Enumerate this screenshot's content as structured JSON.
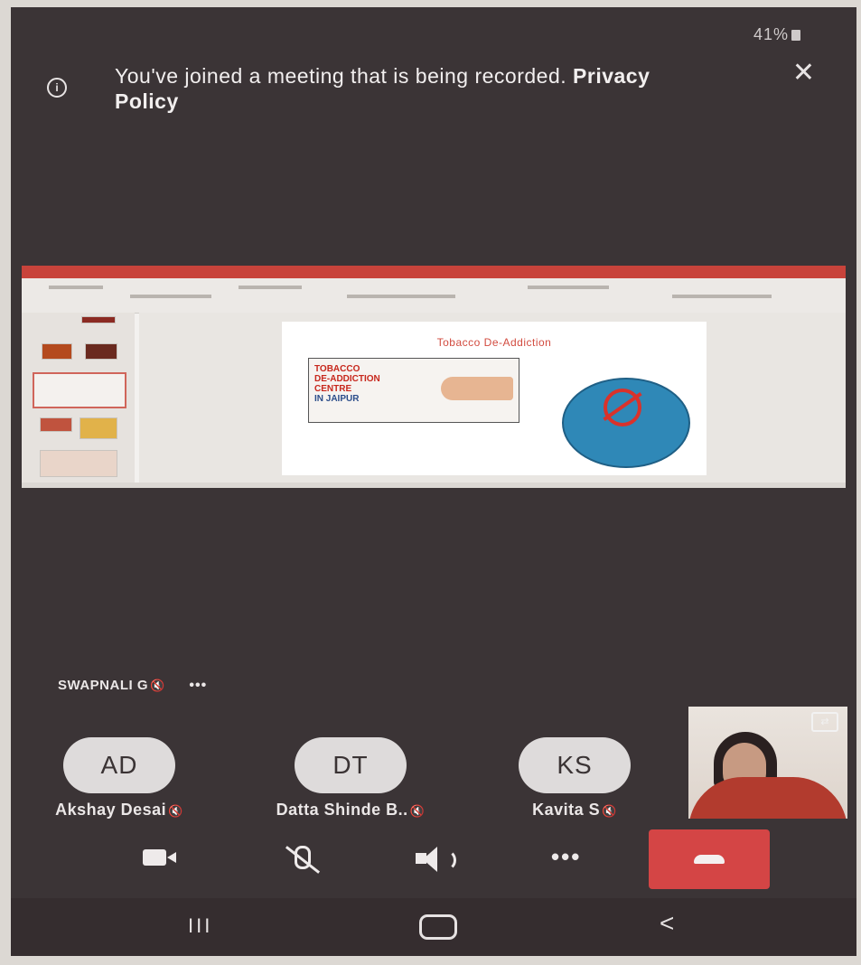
{
  "status_bar": {
    "battery": "41%"
  },
  "banner": {
    "message": "You've joined a meeting that is being recorded.",
    "link": "Privacy Policy",
    "icon": "info-icon"
  },
  "shared_screen": {
    "slide_title": "Tobacco De-Addiction",
    "card_line1": "TOBACCO",
    "card_line2": "DE-ADDICTION",
    "card_line3": "CENTRE",
    "card_line4": "IN JAIPUR"
  },
  "active_speaker": {
    "name": "SWAPNALI G",
    "more": "•••"
  },
  "participants": [
    {
      "initials": "AD",
      "name": "Akshay Desai"
    },
    {
      "initials": "DT",
      "name": "Datta Shinde B.."
    },
    {
      "initials": "KS",
      "name": "Kavita S"
    }
  ],
  "toolbar": {
    "more": "•••",
    "end_call_color": "#d44545"
  },
  "navbar": {
    "recent": "III",
    "back": "<"
  }
}
